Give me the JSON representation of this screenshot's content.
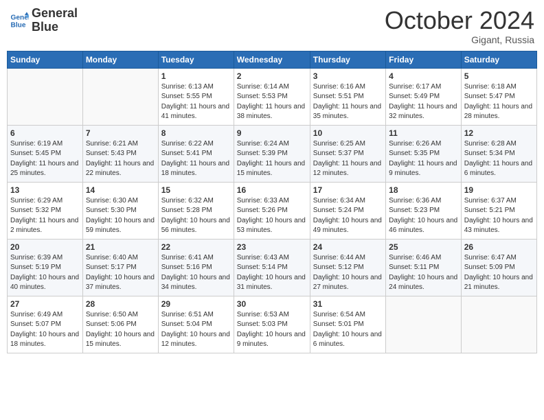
{
  "logo": {
    "line1": "General",
    "line2": "Blue"
  },
  "title": "October 2024",
  "location": "Gigant, Russia",
  "days_header": [
    "Sunday",
    "Monday",
    "Tuesday",
    "Wednesday",
    "Thursday",
    "Friday",
    "Saturday"
  ],
  "weeks": [
    [
      {
        "day": "",
        "info": ""
      },
      {
        "day": "",
        "info": ""
      },
      {
        "day": "1",
        "info": "Sunrise: 6:13 AM\nSunset: 5:55 PM\nDaylight: 11 hours and 41 minutes."
      },
      {
        "day": "2",
        "info": "Sunrise: 6:14 AM\nSunset: 5:53 PM\nDaylight: 11 hours and 38 minutes."
      },
      {
        "day": "3",
        "info": "Sunrise: 6:16 AM\nSunset: 5:51 PM\nDaylight: 11 hours and 35 minutes."
      },
      {
        "day": "4",
        "info": "Sunrise: 6:17 AM\nSunset: 5:49 PM\nDaylight: 11 hours and 32 minutes."
      },
      {
        "day": "5",
        "info": "Sunrise: 6:18 AM\nSunset: 5:47 PM\nDaylight: 11 hours and 28 minutes."
      }
    ],
    [
      {
        "day": "6",
        "info": "Sunrise: 6:19 AM\nSunset: 5:45 PM\nDaylight: 11 hours and 25 minutes."
      },
      {
        "day": "7",
        "info": "Sunrise: 6:21 AM\nSunset: 5:43 PM\nDaylight: 11 hours and 22 minutes."
      },
      {
        "day": "8",
        "info": "Sunrise: 6:22 AM\nSunset: 5:41 PM\nDaylight: 11 hours and 18 minutes."
      },
      {
        "day": "9",
        "info": "Sunrise: 6:24 AM\nSunset: 5:39 PM\nDaylight: 11 hours and 15 minutes."
      },
      {
        "day": "10",
        "info": "Sunrise: 6:25 AM\nSunset: 5:37 PM\nDaylight: 11 hours and 12 minutes."
      },
      {
        "day": "11",
        "info": "Sunrise: 6:26 AM\nSunset: 5:35 PM\nDaylight: 11 hours and 9 minutes."
      },
      {
        "day": "12",
        "info": "Sunrise: 6:28 AM\nSunset: 5:34 PM\nDaylight: 11 hours and 6 minutes."
      }
    ],
    [
      {
        "day": "13",
        "info": "Sunrise: 6:29 AM\nSunset: 5:32 PM\nDaylight: 11 hours and 2 minutes."
      },
      {
        "day": "14",
        "info": "Sunrise: 6:30 AM\nSunset: 5:30 PM\nDaylight: 10 hours and 59 minutes."
      },
      {
        "day": "15",
        "info": "Sunrise: 6:32 AM\nSunset: 5:28 PM\nDaylight: 10 hours and 56 minutes."
      },
      {
        "day": "16",
        "info": "Sunrise: 6:33 AM\nSunset: 5:26 PM\nDaylight: 10 hours and 53 minutes."
      },
      {
        "day": "17",
        "info": "Sunrise: 6:34 AM\nSunset: 5:24 PM\nDaylight: 10 hours and 49 minutes."
      },
      {
        "day": "18",
        "info": "Sunrise: 6:36 AM\nSunset: 5:23 PM\nDaylight: 10 hours and 46 minutes."
      },
      {
        "day": "19",
        "info": "Sunrise: 6:37 AM\nSunset: 5:21 PM\nDaylight: 10 hours and 43 minutes."
      }
    ],
    [
      {
        "day": "20",
        "info": "Sunrise: 6:39 AM\nSunset: 5:19 PM\nDaylight: 10 hours and 40 minutes."
      },
      {
        "day": "21",
        "info": "Sunrise: 6:40 AM\nSunset: 5:17 PM\nDaylight: 10 hours and 37 minutes."
      },
      {
        "day": "22",
        "info": "Sunrise: 6:41 AM\nSunset: 5:16 PM\nDaylight: 10 hours and 34 minutes."
      },
      {
        "day": "23",
        "info": "Sunrise: 6:43 AM\nSunset: 5:14 PM\nDaylight: 10 hours and 31 minutes."
      },
      {
        "day": "24",
        "info": "Sunrise: 6:44 AM\nSunset: 5:12 PM\nDaylight: 10 hours and 27 minutes."
      },
      {
        "day": "25",
        "info": "Sunrise: 6:46 AM\nSunset: 5:11 PM\nDaylight: 10 hours and 24 minutes."
      },
      {
        "day": "26",
        "info": "Sunrise: 6:47 AM\nSunset: 5:09 PM\nDaylight: 10 hours and 21 minutes."
      }
    ],
    [
      {
        "day": "27",
        "info": "Sunrise: 6:49 AM\nSunset: 5:07 PM\nDaylight: 10 hours and 18 minutes."
      },
      {
        "day": "28",
        "info": "Sunrise: 6:50 AM\nSunset: 5:06 PM\nDaylight: 10 hours and 15 minutes."
      },
      {
        "day": "29",
        "info": "Sunrise: 6:51 AM\nSunset: 5:04 PM\nDaylight: 10 hours and 12 minutes."
      },
      {
        "day": "30",
        "info": "Sunrise: 6:53 AM\nSunset: 5:03 PM\nDaylight: 10 hours and 9 minutes."
      },
      {
        "day": "31",
        "info": "Sunrise: 6:54 AM\nSunset: 5:01 PM\nDaylight: 10 hours and 6 minutes."
      },
      {
        "day": "",
        "info": ""
      },
      {
        "day": "",
        "info": ""
      }
    ]
  ]
}
